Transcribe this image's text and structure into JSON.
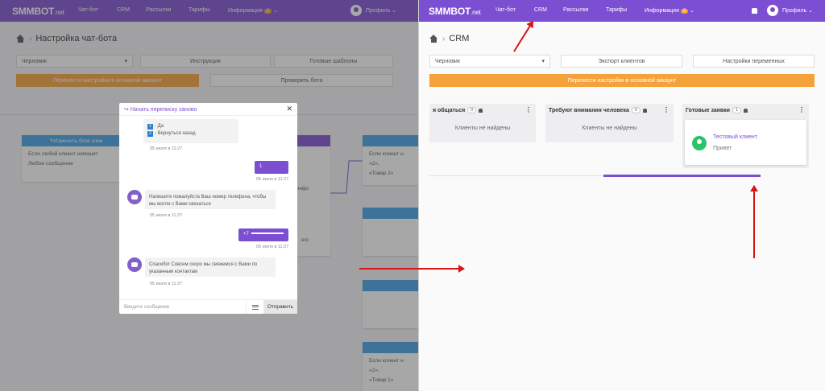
{
  "left": {
    "nav": {
      "logo": "SMMBOT",
      "logo_suffix": ".net",
      "items": [
        "Чат-бот",
        "CRM",
        "Рассылки",
        "Тарифы",
        "Информация"
      ],
      "info_badge": "2",
      "profile": "Профиль"
    },
    "page_title": "Настройка чат-бота",
    "select_value": "Черновик",
    "instruction_button": "Инструкция",
    "templates_button": "Готовые шаблоны",
    "transfer_button": "Перенести настройки в основной аккаунт",
    "check_button": "Проверить бота",
    "nodes": {
      "change_block_header": "Изменить блок клие",
      "if_any_client": "Если любой клиент напишет",
      "any_message": "Любое сообщение",
      "right_if_client": "Если клиент н",
      "right_quote2": "«2»,",
      "right_goods2": "«Товар 2»",
      "right_more_if": "Если клиент н",
      "right_quote": "«2»,",
      "right_goods": "«Товар 1»",
      "mid_label": "инфо",
      "mid_label2": "его"
    },
    "modal": {
      "restart": "Начать переписку заново",
      "opt1": "- Да",
      "opt2": "- Вернуться назад",
      "time1": "05 июля в 11:27",
      "user_msg1": "1",
      "time2": "05 июля в 11:27",
      "bot_msg2": "Напишите пожалуйста Ваш номер телефона, чтобы мы могли с Вами связаться",
      "time3": "05 июля в 11:27",
      "user_msg2": "+7",
      "time4": "05 июля в 11:27",
      "bot_msg3": "Спасибо! Совсем скоро мы свяжемся с Вами по указанным контактам",
      "time5": "05 июля в 11:27",
      "input_placeholder": "Введите сообщение",
      "send": "Отправить"
    }
  },
  "right": {
    "nav": {
      "logo": "SMMBOT",
      "logo_suffix": ".net",
      "items": [
        "Чат-бот",
        "CRM",
        "Рассылки",
        "Тарифы",
        "Информация"
      ],
      "info_badge": "2",
      "profile": "Профиль"
    },
    "page_title": "CRM",
    "select_value": "Черновик",
    "export_button": "Экспорт клиентов",
    "variables_button": "Настройки переменных",
    "transfer_button": "Перенести настройки в основной аккаунт",
    "columns": [
      {
        "title": "я общаться",
        "count": "0",
        "empty": "Клиенты не найдены"
      },
      {
        "title": "Требуют внимания человека",
        "count": "0",
        "empty": "Клиенты не найдены"
      },
      {
        "title": "Готовые заявки",
        "count": "1"
      }
    ],
    "card": {
      "name": "Тестовый клиент",
      "message": "Привет"
    }
  },
  "colors": {
    "nav": "#7c4ed1",
    "orange": "#f6a23a",
    "green": "#2ec26a",
    "arrow": "#d81414"
  }
}
